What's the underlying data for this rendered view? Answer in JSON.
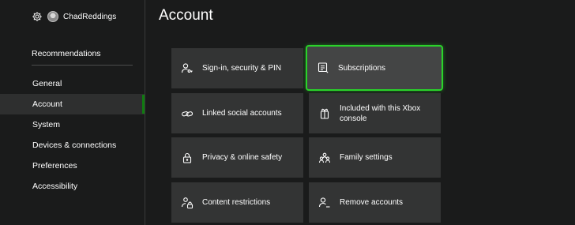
{
  "header": {
    "username": "ChadReddings"
  },
  "sidebar": {
    "recommendations": "Recommendations",
    "items": [
      {
        "label": "General"
      },
      {
        "label": "Account"
      },
      {
        "label": "System"
      },
      {
        "label": "Devices & connections"
      },
      {
        "label": "Preferences"
      },
      {
        "label": "Accessibility"
      }
    ]
  },
  "main": {
    "title": "Account",
    "tiles": [
      {
        "label": "Sign-in, security & PIN",
        "icon": "person-key-icon"
      },
      {
        "label": "Subscriptions",
        "icon": "subscription-icon"
      },
      {
        "label": "Linked social accounts",
        "icon": "link-icon"
      },
      {
        "label": "Included with this Xbox console",
        "icon": "gift-icon"
      },
      {
        "label": "Privacy & online safety",
        "icon": "lock-icon"
      },
      {
        "label": "Family settings",
        "icon": "family-icon"
      },
      {
        "label": "Content restrictions",
        "icon": "content-lock-icon"
      },
      {
        "label": "Remove accounts",
        "icon": "remove-person-icon"
      }
    ]
  },
  "colors": {
    "accent": "#107c10",
    "focus": "#2ad32a",
    "tile": "#333434",
    "background": "#1a1b1b"
  }
}
